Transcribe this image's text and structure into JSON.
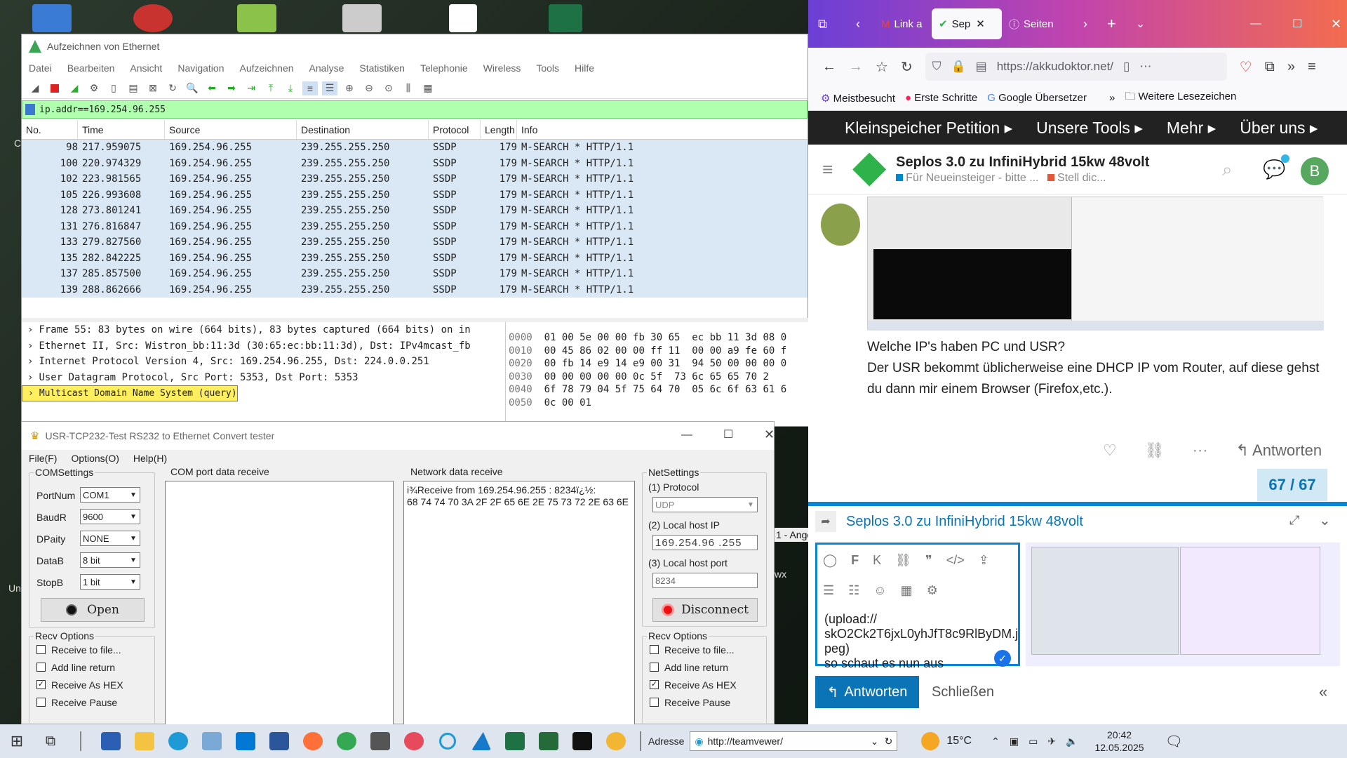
{
  "desktop": {
    "clipped_labels": [
      "C",
      "Un",
      "wx",
      "1 - Ange"
    ]
  },
  "wireshark": {
    "title": "Aufzeichnen von Ethernet",
    "menu": [
      "Datei",
      "Bearbeiten",
      "Ansicht",
      "Navigation",
      "Aufzeichnen",
      "Analyse",
      "Statistiken",
      "Telephonie",
      "Wireless",
      "Tools",
      "Hilfe"
    ],
    "filter": "ip.addr==169.254.96.255",
    "columns": [
      "No.",
      "Time",
      "Source",
      "Destination",
      "Protocol",
      "Length",
      "Info"
    ],
    "rows": [
      {
        "no": "98",
        "time": "217.959075",
        "src": "169.254.96.255",
        "dst": "239.255.255.250",
        "proto": "SSDP",
        "len": "179",
        "info": "M-SEARCH * HTTP/1.1"
      },
      {
        "no": "100",
        "time": "220.974329",
        "src": "169.254.96.255",
        "dst": "239.255.255.250",
        "proto": "SSDP",
        "len": "179",
        "info": "M-SEARCH * HTTP/1.1"
      },
      {
        "no": "102",
        "time": "223.981565",
        "src": "169.254.96.255",
        "dst": "239.255.255.250",
        "proto": "SSDP",
        "len": "179",
        "info": "M-SEARCH * HTTP/1.1"
      },
      {
        "no": "105",
        "time": "226.993608",
        "src": "169.254.96.255",
        "dst": "239.255.255.250",
        "proto": "SSDP",
        "len": "179",
        "info": "M-SEARCH * HTTP/1.1"
      },
      {
        "no": "128",
        "time": "273.801241",
        "src": "169.254.96.255",
        "dst": "239.255.255.250",
        "proto": "SSDP",
        "len": "179",
        "info": "M-SEARCH * HTTP/1.1"
      },
      {
        "no": "131",
        "time": "276.816847",
        "src": "169.254.96.255",
        "dst": "239.255.255.250",
        "proto": "SSDP",
        "len": "179",
        "info": "M-SEARCH * HTTP/1.1"
      },
      {
        "no": "133",
        "time": "279.827560",
        "src": "169.254.96.255",
        "dst": "239.255.255.250",
        "proto": "SSDP",
        "len": "179",
        "info": "M-SEARCH * HTTP/1.1"
      },
      {
        "no": "135",
        "time": "282.842225",
        "src": "169.254.96.255",
        "dst": "239.255.255.250",
        "proto": "SSDP",
        "len": "179",
        "info": "M-SEARCH * HTTP/1.1"
      },
      {
        "no": "137",
        "time": "285.857500",
        "src": "169.254.96.255",
        "dst": "239.255.255.250",
        "proto": "SSDP",
        "len": "179",
        "info": "M-SEARCH * HTTP/1.1"
      },
      {
        "no": "139",
        "time": "288.862666",
        "src": "169.254.96.255",
        "dst": "239.255.255.250",
        "proto": "SSDP",
        "len": "179",
        "info": "M-SEARCH * HTTP/1.1"
      }
    ],
    "details": [
      "Frame 55: 83 bytes on wire (664 bits), 83 bytes captured (664 bits) on in",
      "Ethernet II, Src: Wistron_bb:11:3d (30:65:ec:bb:11:3d), Dst: IPv4mcast_fb",
      "Internet Protocol Version 4, Src: 169.254.96.255, Dst: 224.0.0.251",
      "User Datagram Protocol, Src Port: 5353, Dst Port: 5353",
      "Multicast Domain Name System (query)"
    ],
    "hex": [
      {
        "off": "0000",
        "bytes": "01 00 5e 00 00 fb 30 65  ec bb 11 3d 08 0"
      },
      {
        "off": "0010",
        "bytes": "00 45 86 02 00 00 ff 11  00 00 a9 fe 60 f"
      },
      {
        "off": "0020",
        "bytes": "00 fb 14 e9 14 e9 00 31  94 50 00 00 00 0"
      },
      {
        "off": "0030",
        "bytes": "00 00 00 00 00 0c 5f  73 6c 65 65 70 2"
      },
      {
        "off": "0040",
        "bytes": "6f 78 79 04 5f 75 64 70  05 6c 6f 63 61 6"
      },
      {
        "off": "0050",
        "bytes": "0c 00 01"
      }
    ]
  },
  "usr": {
    "title": "USR-TCP232-Test  RS232 to Ethernet Convert tester",
    "menu": [
      "File(F)",
      "Options(O)",
      "Help(H)"
    ],
    "com_settings": {
      "title": "COMSettings",
      "fields": [
        {
          "label": "PortNum",
          "value": "COM1"
        },
        {
          "label": "BaudR",
          "value": "9600"
        },
        {
          "label": "DPaity",
          "value": "NONE"
        },
        {
          "label": "DataB",
          "value": "8 bit"
        },
        {
          "label": "StopB",
          "value": "1 bit"
        }
      ],
      "open_label": "Open"
    },
    "com_receive_title": "COM port data receive",
    "net_receive_title": "Network data receive",
    "net_receive_text": "i¾Receive from 169.254.96.255 : 8234ï¿½:\n68 74 74 70 3A 2F 2F 65 6E 2E 75 73 72 2E 63 6E",
    "net_settings": {
      "title": "NetSettings",
      "protocol_label": "(1) Protocol",
      "protocol": "UDP",
      "host_ip_label": "(2) Local host IP",
      "host_ip": "169.254.96 .255",
      "host_port_label": "(3) Local host port",
      "host_port": "8234",
      "disconnect_label": "Disconnect"
    },
    "recv_options": {
      "title": "Recv Options",
      "items": [
        {
          "label": "Receive to file...",
          "checked": false
        },
        {
          "label": "Add line return",
          "checked": false
        },
        {
          "label": "Receive As HEX",
          "checked": true
        },
        {
          "label": "Receive Pause",
          "checked": false
        }
      ]
    }
  },
  "browser": {
    "tabs": [
      {
        "label": "Link a"
      },
      {
        "label": "Sep"
      },
      {
        "label": "Seiten"
      }
    ],
    "url": "https://akkudoktor.net/",
    "bookmarks": [
      "Meistbesucht",
      "Erste Schritte",
      "Google Übersetzer",
      "Weitere Lesezeichen"
    ],
    "site_nav": [
      "Kleinspeicher Petition",
      "Unsere Tools",
      "Mehr",
      "Über uns"
    ],
    "topic": {
      "title": "Seplos 3.0 zu InfiniHybrid 15kw 48volt",
      "cat1": "Für Neueinsteiger - bitte ...",
      "cat2": "Stell dic...",
      "avatar_letter": "B"
    },
    "post": {
      "line1": "Welche IP's haben PC und USR?",
      "line2": "Der USR bekommt üblicherweise eine DHCP IP vom Router, auf diese gehst du dann mir einem Browser (Firefox,etc.).",
      "reply_label": "Antworten",
      "progress": "67 / 67"
    },
    "composer": {
      "title": "Seplos 3.0 zu InfiniHybrid 15kw 48volt",
      "text_lines": [
        "(upload://",
        "skO2Ck2T6jxL0yhJfT8c9RlByDM.j",
        "peg)",
        "so schaut es nun aus"
      ],
      "reply_label": "Antworten",
      "close_label": "Schließen"
    }
  },
  "taskbar": {
    "address_label": "Adresse",
    "address_value": "http://teamvewer/",
    "temperature": "15°C",
    "time": "20:42",
    "date": "12.05.2025"
  }
}
